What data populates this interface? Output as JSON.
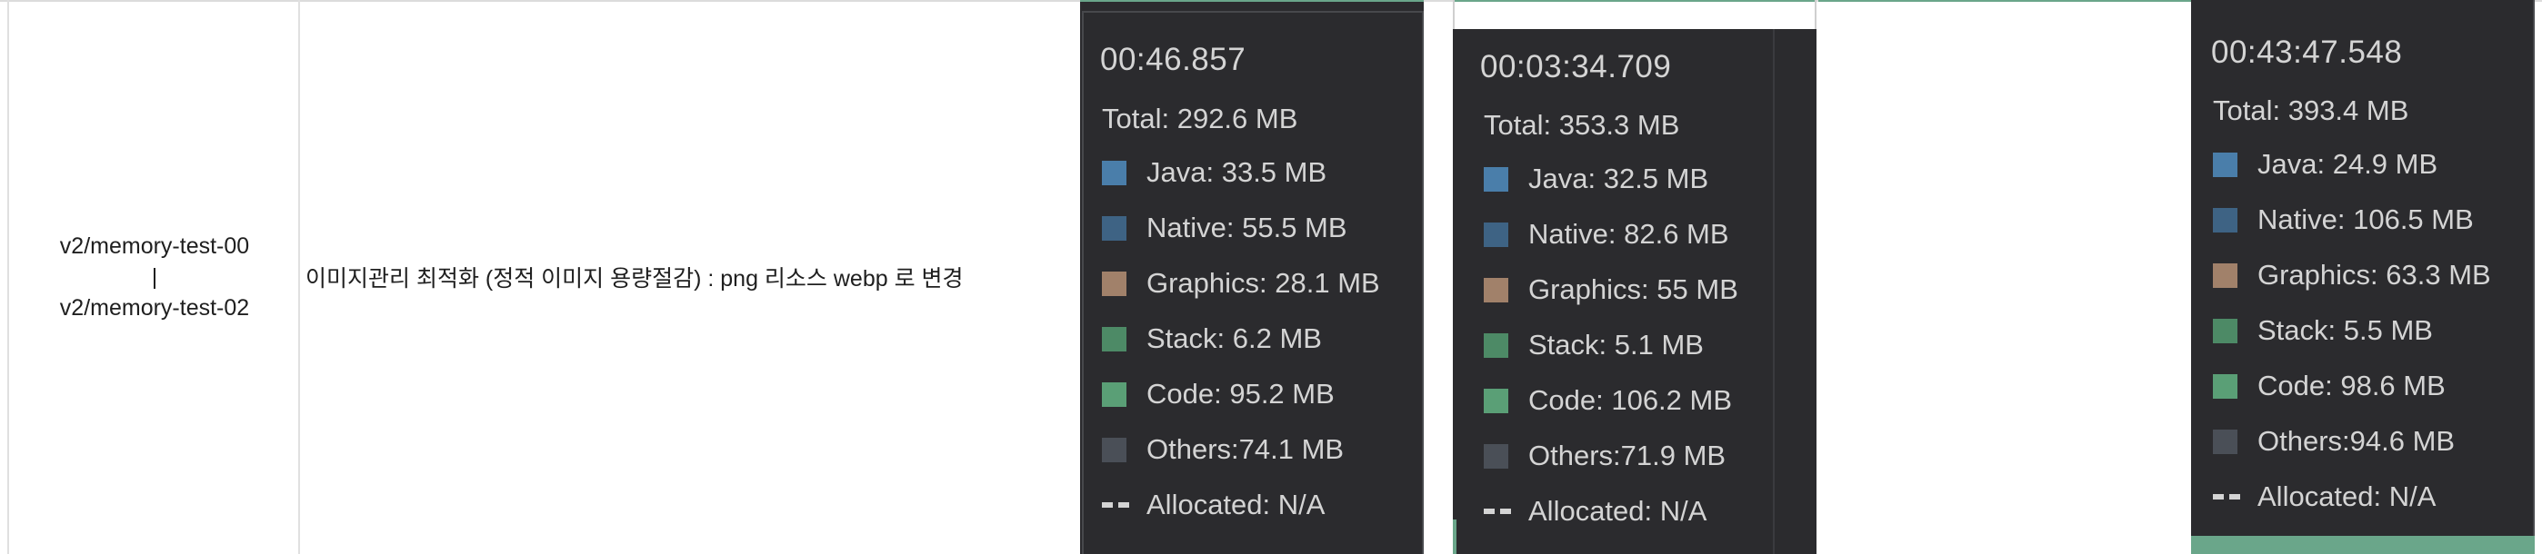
{
  "row": {
    "branch_from": "v2/memory-test-00",
    "branch_sep": "|",
    "branch_to": "v2/memory-test-02",
    "description": "이미지관리 최적화 (정적 이미지 용량절감) : png 리소스 webp 로 변경"
  },
  "legend_colors": {
    "java": "#4a7eaa",
    "native": "#3e6384",
    "graphics": "#a1816a",
    "stack": "#4d8a66",
    "code": "#5a9f76",
    "others": "#4a4f57",
    "allocated": "#d4d4d4"
  },
  "panels": [
    {
      "time": "00:46.857",
      "total": "Total: 292.6 MB",
      "java": "Java: 33.5 MB",
      "native": "Native: 55.5 MB",
      "graphics": "Graphics: 28.1 MB",
      "stack": "Stack: 6.2 MB",
      "code": "Code: 95.2 MB",
      "others": "Others:74.1 MB",
      "allocated": "Allocated: N/A"
    },
    {
      "time": "00:03:34.709",
      "total": "Total: 353.3 MB",
      "java": "Java: 32.5 MB",
      "native": "Native: 82.6 MB",
      "graphics": "Graphics: 55 MB",
      "stack": "Stack: 5.1 MB",
      "code": "Code: 106.2 MB",
      "others": "Others:71.9 MB",
      "allocated": "Allocated: N/A"
    },
    {
      "time": "00:43:47.548",
      "total": "Total: 393.4 MB",
      "java": "Java: 24.9 MB",
      "native": "Native: 106.5 MB",
      "graphics": "Graphics: 63.3 MB",
      "stack": "Stack: 5.5 MB",
      "code": "Code: 98.6 MB",
      "others": "Others:94.6 MB",
      "allocated": "Allocated: N/A"
    }
  ]
}
